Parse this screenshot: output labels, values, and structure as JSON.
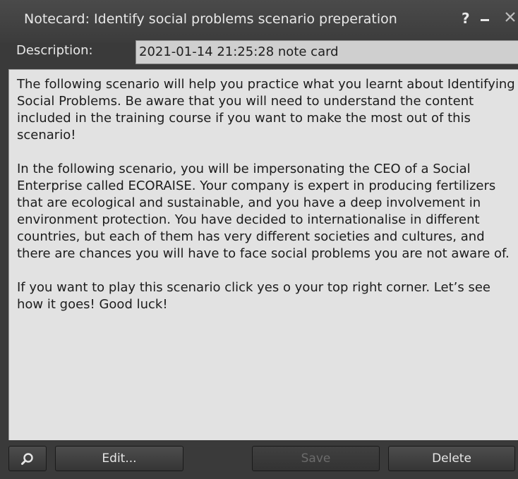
{
  "window": {
    "title": "Notecard: Identify social problems scenario preperation",
    "help_label": "?"
  },
  "description": {
    "label": "Description:",
    "value": "2021-01-14 21:25:28 note card"
  },
  "note": {
    "paragraphs": [
      "The following scenario will help you practice what you learnt about Identifying Social Problems. Be aware that you will need to understand the content included in the training course if you want to make the most out of this scenario!",
      "In the following scenario, you will be impersonating the CEO of a Social Enterprise called ECORAISE. Your company is expert in producing fertilizers that are ecological and sustainable, and you have a deep involvement in environment protection. You have decided to internationalise in different countries, but each of them has very different societies and cultures, and there are chances you will have to face social problems you are not aware of.",
      "If you want to play this scenario click yes o your top right corner. Let’s see how it goes! Good luck!"
    ]
  },
  "toolbar": {
    "search_icon": "magnifier-icon",
    "edit_label": "Edit...",
    "save_label": "Save",
    "delete_label": "Delete"
  },
  "colors": {
    "window_bg": "#3a3a3a",
    "note_bg": "#e2e2e2",
    "input_bg": "#cfcfcf",
    "disabled_text": "#6b6b6b"
  }
}
